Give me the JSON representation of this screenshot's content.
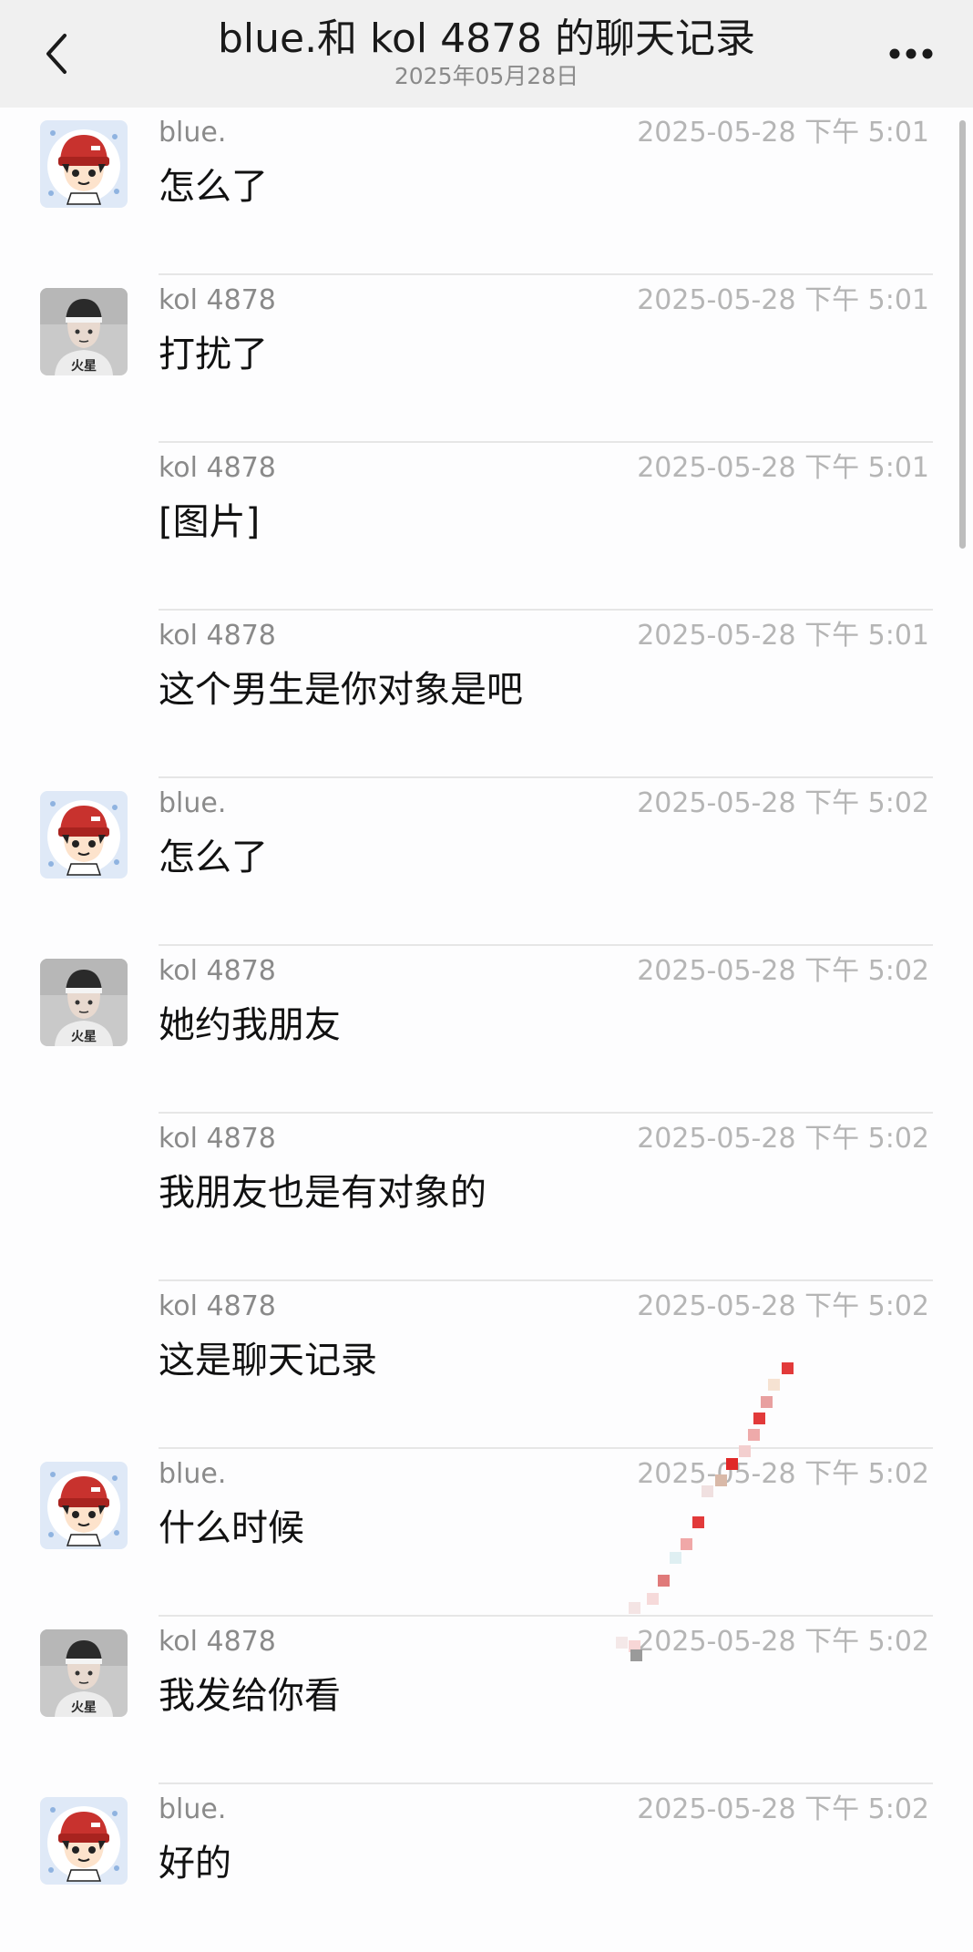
{
  "header": {
    "title": "blue.和 kol 4878 的聊天记录",
    "date": "2025年05月28日",
    "back_icon": "chevron-left-icon",
    "more_icon": "more-dots-icon"
  },
  "messages": [
    {
      "sender": "blue.",
      "avatar": "blue",
      "show_avatar": true,
      "time": "2025-05-28 下午 5:01",
      "text": "怎么了"
    },
    {
      "sender": "kol 4878",
      "avatar": "kol",
      "show_avatar": true,
      "time": "2025-05-28 下午 5:01",
      "text": "打扰了"
    },
    {
      "sender": "kol 4878",
      "avatar": "kol",
      "show_avatar": false,
      "time": "2025-05-28 下午 5:01",
      "text": "[图片]"
    },
    {
      "sender": "kol 4878",
      "avatar": "kol",
      "show_avatar": false,
      "time": "2025-05-28 下午 5:01",
      "text": "这个男生是你对象是吧"
    },
    {
      "sender": "blue.",
      "avatar": "blue",
      "show_avatar": true,
      "time": "2025-05-28 下午 5:02",
      "text": "怎么了"
    },
    {
      "sender": "kol 4878",
      "avatar": "kol",
      "show_avatar": true,
      "time": "2025-05-28 下午 5:02",
      "text": "她约我朋友"
    },
    {
      "sender": "kol 4878",
      "avatar": "kol",
      "show_avatar": false,
      "time": "2025-05-28 下午 5:02",
      "text": "我朋友也是有对象的"
    },
    {
      "sender": "kol 4878",
      "avatar": "kol",
      "show_avatar": false,
      "time": "2025-05-28 下午 5:02",
      "text": "这是聊天记录"
    },
    {
      "sender": "blue.",
      "avatar": "blue",
      "show_avatar": true,
      "time": "2025-05-28 下午 5:02",
      "text": "什么时候"
    },
    {
      "sender": "kol 4878",
      "avatar": "kol",
      "show_avatar": true,
      "time": "2025-05-28 下午 5:02",
      "text": "我发给你看"
    },
    {
      "sender": "blue.",
      "avatar": "blue",
      "show_avatar": true,
      "time": "2025-05-28 下午 5:02",
      "text": "好的"
    }
  ],
  "colors": {
    "header_bg": "#f0f0f0",
    "page_bg": "#fdfdfe",
    "meta_text": "#8a8a8a",
    "time_text": "#b5b5b5",
    "message_text": "#111111",
    "divider": "#e6e6e6"
  }
}
